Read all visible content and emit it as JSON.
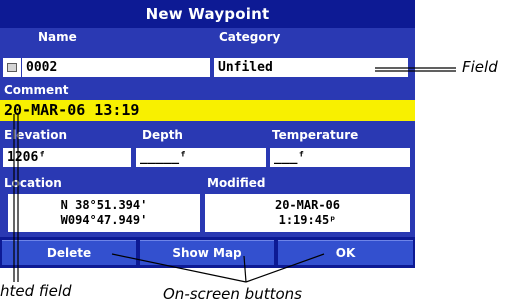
{
  "window": {
    "title": "New Waypoint"
  },
  "labels": {
    "name": "Name",
    "category": "Category",
    "comment": "Comment",
    "elevation": "Elevation",
    "depth": "Depth",
    "temperature": "Temperature",
    "location": "Location",
    "modified": "Modified"
  },
  "fields": {
    "name_value": "0002",
    "category_value": "Unfiled",
    "comment_value": "20-MAR-06 13:19",
    "elevation_value": "1206ᶠ",
    "depth_value": "_____ᶠ",
    "temperature_value": "___ᶠ",
    "location_lat": "N  38°51.394'",
    "location_lon": "W094°47.949'",
    "modified_date": "20-MAR-06",
    "modified_time": "1:19:45ᵖ"
  },
  "buttons": {
    "delete": "Delete",
    "show_map": "Show Map",
    "ok": "OK"
  },
  "callouts": {
    "field": "Field",
    "highlighted_field": "hted field",
    "on_screen_buttons": "On-screen buttons"
  },
  "colors": {
    "screen_bg": "#2a39b3",
    "title_bar": "#0d1a94",
    "highlight": "#f8f000",
    "button": "#3350cf"
  }
}
